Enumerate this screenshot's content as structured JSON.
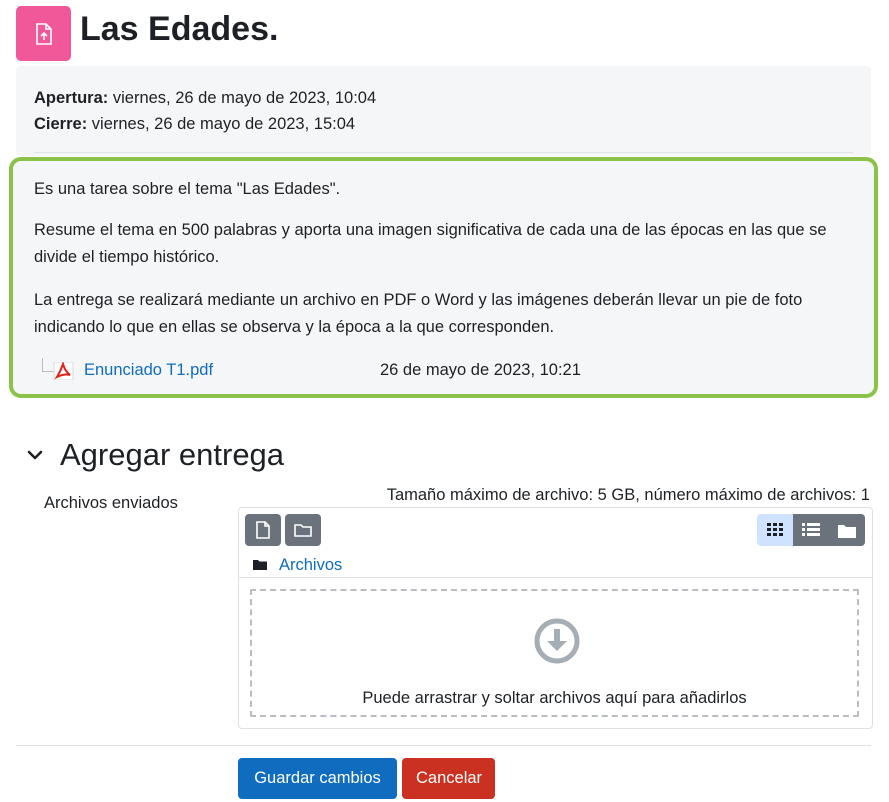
{
  "header": {
    "title": "Las Edades.",
    "icon": "assignment-upload-icon",
    "icon_color": "#f0589a"
  },
  "dates": {
    "open_label": "Apertura:",
    "open_value": "viernes, 26 de mayo de 2023, 10:04",
    "close_label": "Cierre:",
    "close_value": "viernes, 26 de mayo de 2023, 15:04"
  },
  "description": {
    "paragraphs": [
      "Es una tarea sobre el tema \"Las Edades\".",
      "Resume el tema en 500 palabras y aporta una imagen significativa de cada una de las épocas en las que se divide el tiempo histórico.",
      "La entrega se realizará mediante un archivo en PDF o Word y las imágenes deberán llevar un pie de foto indicando lo que en ellas se observa y la época a la que corresponden."
    ],
    "attachment": {
      "name": "Enunciado T1.pdf",
      "date": "26 de mayo de 2023, 10:21",
      "icon": "pdf-file-icon"
    },
    "highlight_color": "#8bc34a"
  },
  "submission": {
    "section_title": "Agregar entrega",
    "files_label": "Archivos enviados",
    "max_size_text": "Tamaño máximo de archivo: 5 GB, número máximo de archivos: 1",
    "breadcrumb": "Archivos",
    "drop_text": "Puede arrastrar y soltar archivos aquí para añadirlos"
  },
  "buttons": {
    "save": "Guardar cambios",
    "cancel": "Cancelar"
  },
  "colors": {
    "primary": "#0f6cbf",
    "danger": "#ca3120"
  }
}
